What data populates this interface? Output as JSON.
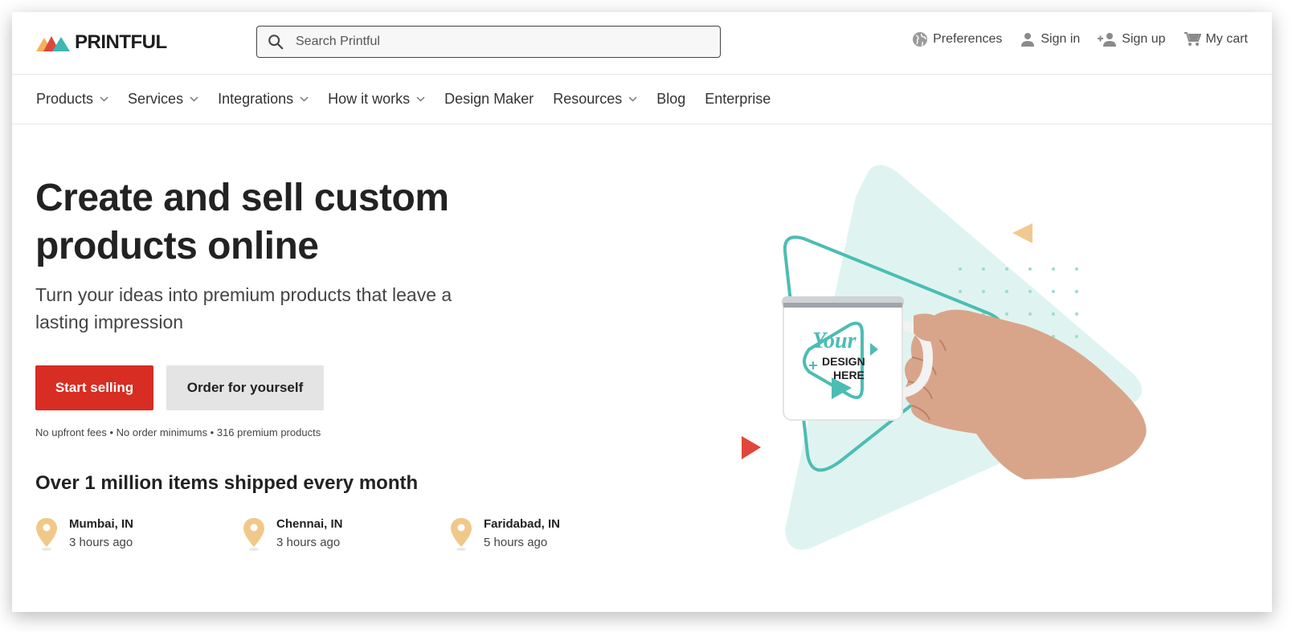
{
  "header": {
    "logo_text": "PRINTFUL",
    "search_placeholder": "Search Printful",
    "actions": [
      {
        "label": "Preferences",
        "icon": "globe-icon"
      },
      {
        "label": "Sign in",
        "icon": "user-icon"
      },
      {
        "label": "Sign up",
        "icon": "user-plus-icon"
      },
      {
        "label": "My cart",
        "icon": "cart-icon"
      }
    ]
  },
  "nav": [
    {
      "label": "Products",
      "dropdown": true
    },
    {
      "label": "Services",
      "dropdown": true
    },
    {
      "label": "Integrations",
      "dropdown": true
    },
    {
      "label": "How it works",
      "dropdown": true
    },
    {
      "label": "Design Maker",
      "dropdown": false
    },
    {
      "label": "Resources",
      "dropdown": true
    },
    {
      "label": "Blog",
      "dropdown": false
    },
    {
      "label": "Enterprise",
      "dropdown": false
    }
  ],
  "hero": {
    "title_line1": "Create and sell custom",
    "title_line2": "products online",
    "subtitle": "Turn your ideas into premium products that leave a lasting impression",
    "primary_button": "Start selling",
    "secondary_button": "Order for yourself",
    "fine_print": "No upfront fees • No order minimums • 316 premium products"
  },
  "shipped": {
    "heading": "Over 1 million items shipped every month",
    "locations": [
      {
        "city": "Mumbai, IN",
        "time": "3 hours ago"
      },
      {
        "city": "Chennai, IN",
        "time": "3 hours ago"
      },
      {
        "city": "Faridabad, IN",
        "time": "5 hours ago"
      }
    ]
  },
  "mug": {
    "line1": "Your",
    "line2": "DESIGN",
    "line3": "HERE"
  },
  "colors": {
    "brand_red": "#d72d23",
    "teal": "#4cbdb3",
    "teal_light": "#dff4f1",
    "pin": "#f0c98a"
  }
}
